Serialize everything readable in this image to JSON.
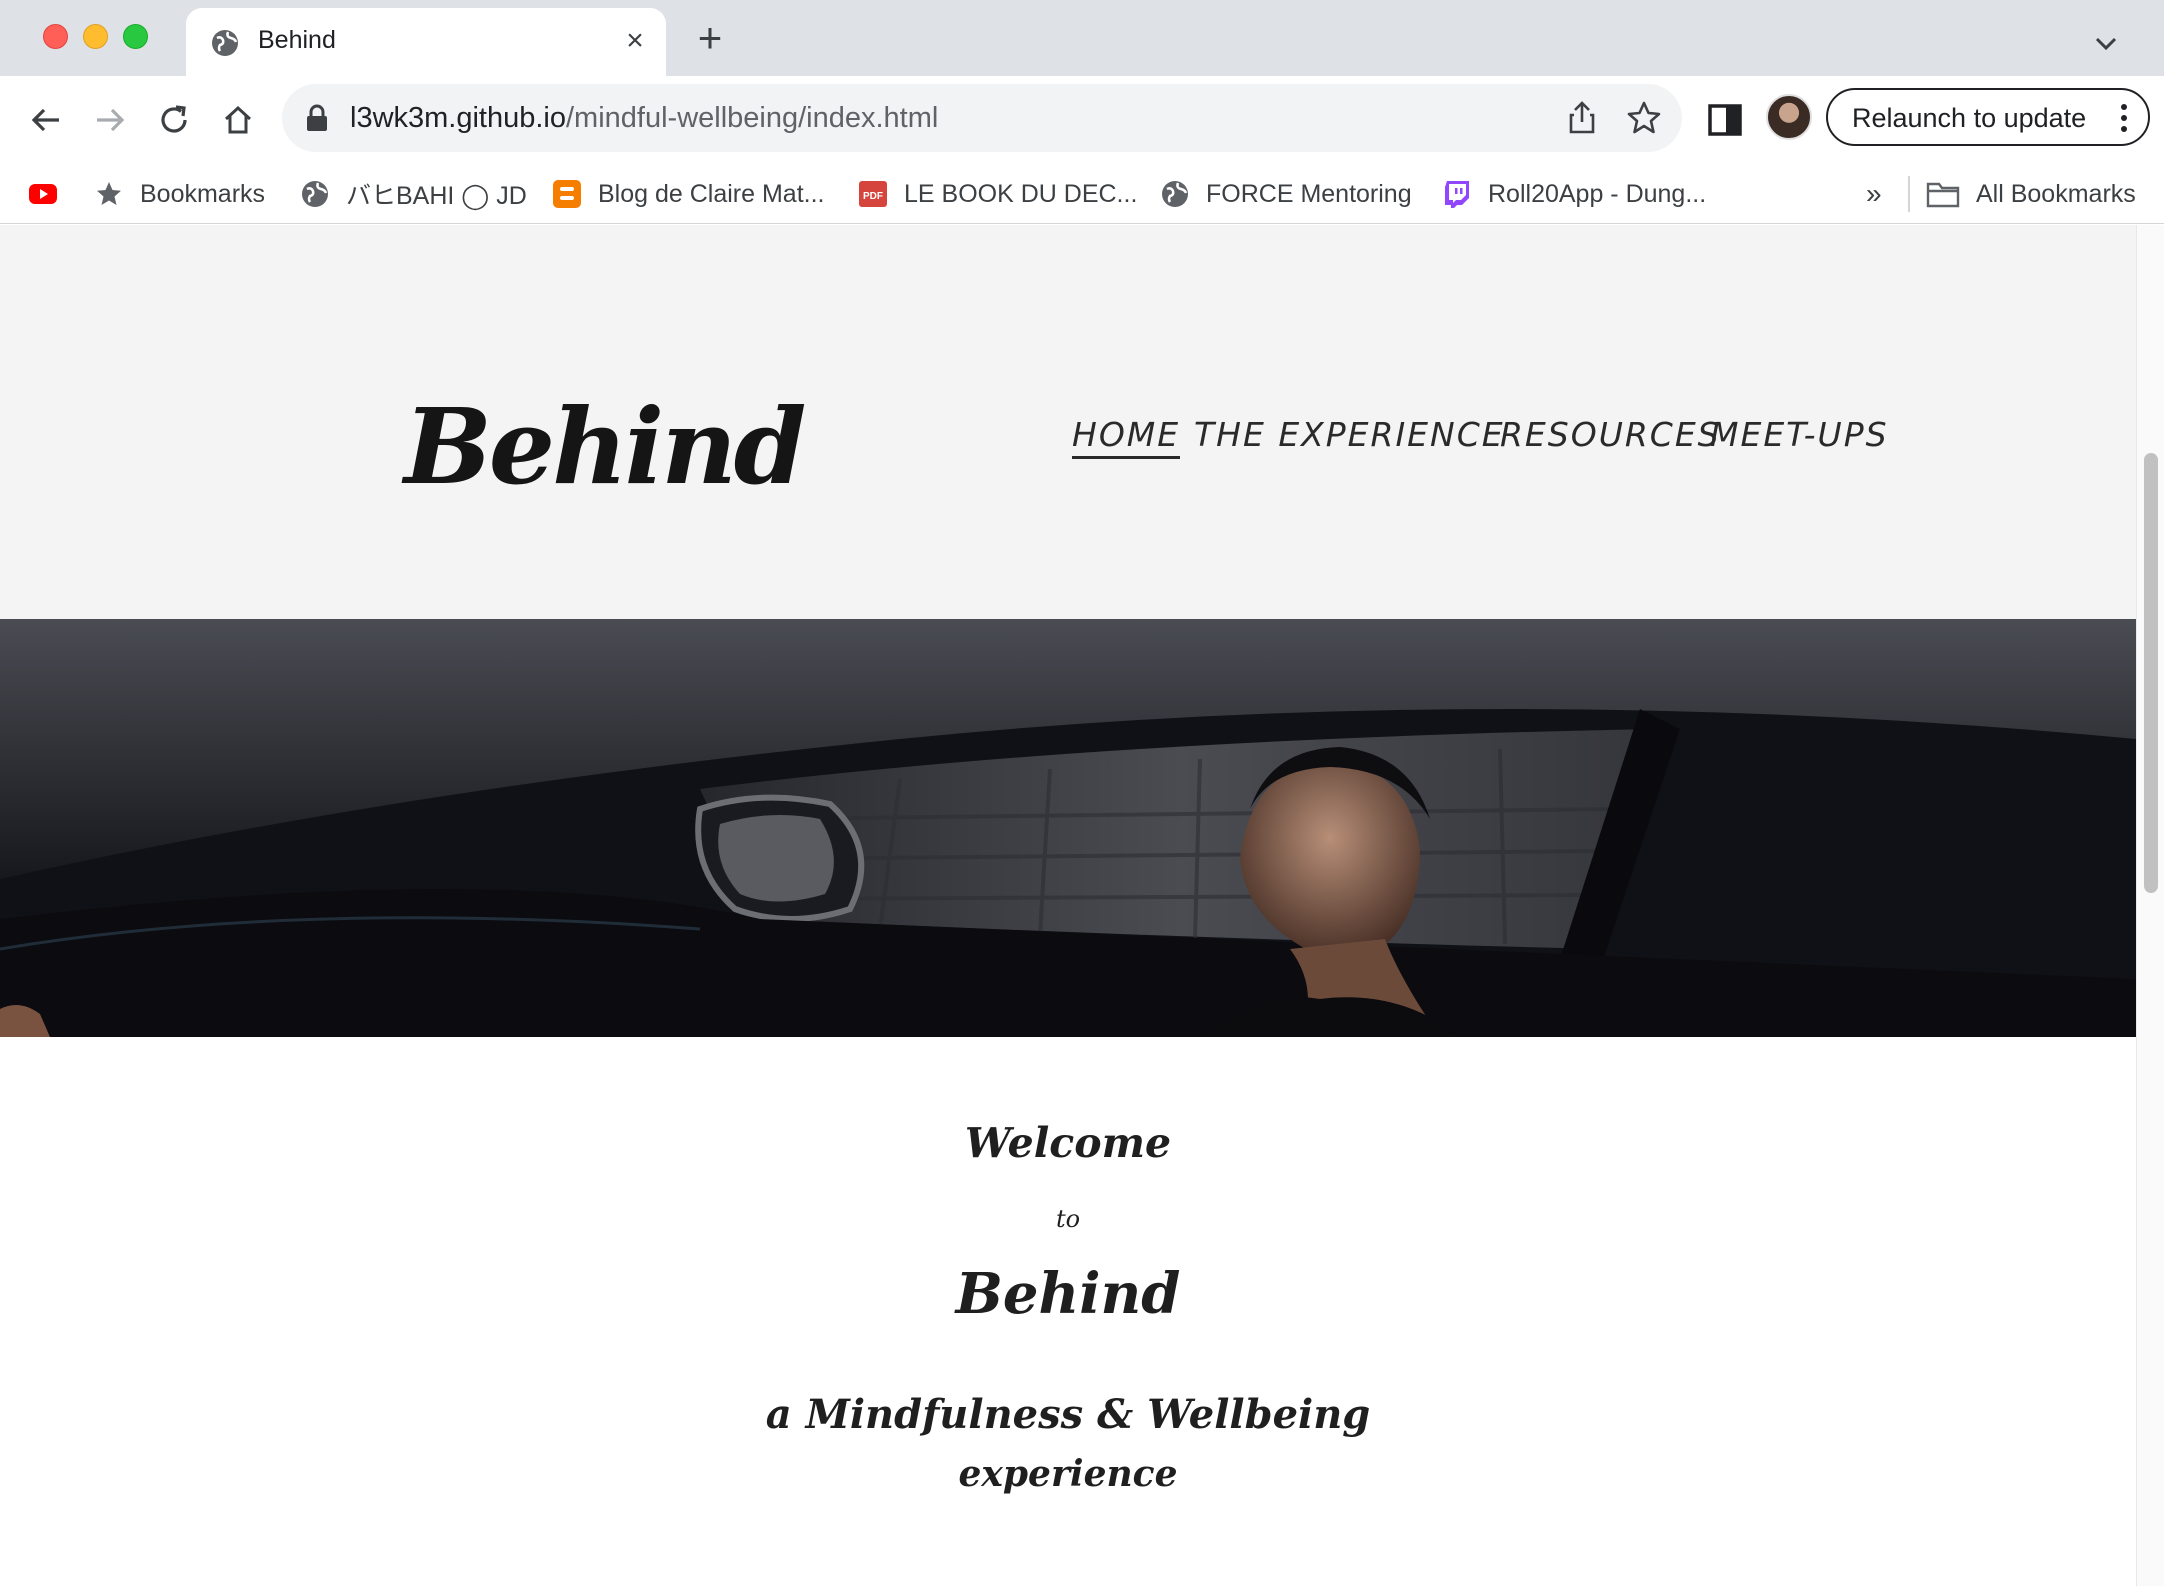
{
  "browser": {
    "tab": {
      "title": "Behind"
    },
    "url": {
      "host": "l3wk3m.github.io",
      "path": "/mindful-wellbeing/index.html"
    },
    "relaunch_label": "Relaunch to update"
  },
  "bookmarks": [
    {
      "label": "",
      "icon": "youtube-icon"
    },
    {
      "label": "Bookmarks",
      "icon": "star-icon"
    },
    {
      "label": "バヒBAHI ◯ JD",
      "icon": "globe-icon"
    },
    {
      "label": "Blog de Claire Mat...",
      "icon": "blogger-icon"
    },
    {
      "label": "LE BOOK DU DEC...",
      "icon": "pdf-icon"
    },
    {
      "label": "FORCE Mentoring",
      "icon": "globe-icon"
    },
    {
      "label": "Roll20App - Dung...",
      "icon": "twitch-icon"
    }
  ],
  "bookmarks_overflow": "»",
  "all_bookmarks": "All Bookmarks",
  "site": {
    "logo": "Behind",
    "nav": [
      "HOME",
      "THE EXPERIENCE",
      "RESOURCES",
      "MEET-UPS"
    ],
    "welcome": {
      "line1": "Welcome",
      "line2": "to",
      "line3": "Behind",
      "tagline1": "a Mindfulness & Wellbeing",
      "tagline2": "experience"
    }
  }
}
